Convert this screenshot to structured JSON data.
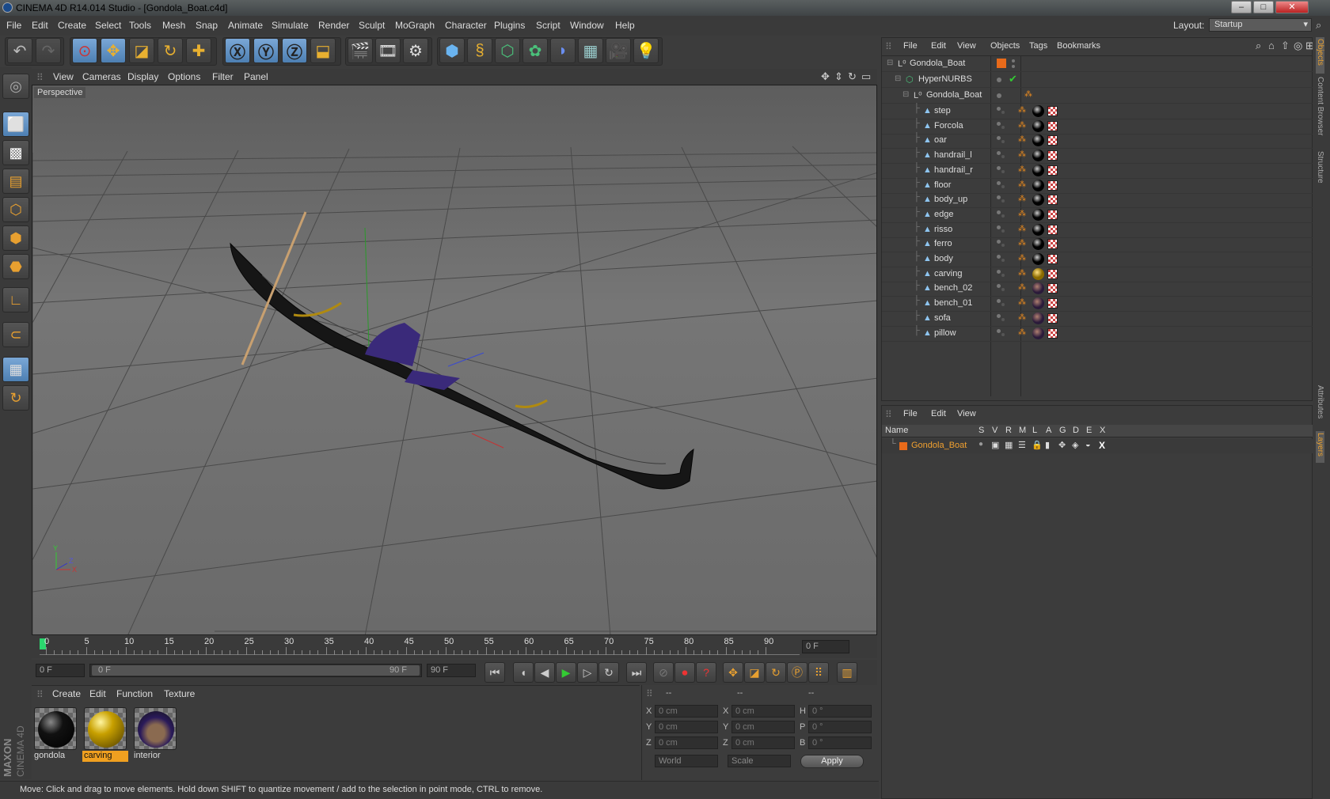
{
  "window": {
    "title": "CINEMA 4D R14.014 Studio - [Gondola_Boat.c4d]"
  },
  "menu": [
    "File",
    "Edit",
    "Create",
    "Select",
    "Tools",
    "Mesh",
    "Snap",
    "Animate",
    "Simulate",
    "Render",
    "Sculpt",
    "MoGraph",
    "Character",
    "Plugins",
    "Script",
    "Window",
    "Help"
  ],
  "layout": {
    "label": "Layout:",
    "value": "Startup"
  },
  "viewport": {
    "menu": [
      "View",
      "Cameras",
      "Display",
      "Options",
      "Filter",
      "Panel"
    ],
    "label": "Perspective"
  },
  "timeline": {
    "ticks": [
      "0",
      "5",
      "10",
      "15",
      "20",
      "25",
      "30",
      "35",
      "40",
      "45",
      "50",
      "55",
      "60",
      "65",
      "70",
      "75",
      "80",
      "85",
      "90"
    ],
    "frame_display": "0 F",
    "start_field": "0 F",
    "range_start": "0 F",
    "range_end": "90 F",
    "end_field": "90 F"
  },
  "materials": {
    "menu": [
      "Create",
      "Edit",
      "Function",
      "Texture"
    ],
    "items": [
      {
        "name": "gondola",
        "color": "#111111"
      },
      {
        "name": "carving",
        "color": "#c8a000"
      },
      {
        "name": "interior",
        "color": "#4a3a7a"
      }
    ]
  },
  "coords": {
    "headers": [
      "--",
      "--",
      "--"
    ],
    "rows": [
      {
        "a": "X",
        "av": "0 cm",
        "b": "X",
        "bv": "0 cm",
        "c": "H",
        "cv": "0 °"
      },
      {
        "a": "Y",
        "av": "0 cm",
        "b": "Y",
        "bv": "0 cm",
        "c": "P",
        "cv": "0 °"
      },
      {
        "a": "Z",
        "av": "0 cm",
        "b": "Z",
        "bv": "0 cm",
        "c": "B",
        "cv": "0 °"
      }
    ],
    "world": "World",
    "scale": "Scale",
    "apply": "Apply"
  },
  "status": "Move: Click and drag to move elements. Hold down SHIFT to quantize movement / add to the selection in point mode, CTRL to remove.",
  "objects": {
    "menu": [
      "File",
      "Edit",
      "View",
      "Objects",
      "Tags",
      "Bookmarks"
    ],
    "root": "Gondola_Boat",
    "nurbs": "HyperNURBS",
    "group": "Gondola_Boat",
    "items": [
      "step",
      "Forcola",
      "oar",
      "handrail_l",
      "handrail_r",
      "floor",
      "body_up",
      "edge",
      "risso",
      "ferro",
      "body",
      "carving",
      "bench_02",
      "bench_01",
      "sofa",
      "pillow"
    ]
  },
  "layers": {
    "menu": [
      "File",
      "Edit",
      "View"
    ],
    "header": {
      "name": "Name",
      "cols": [
        "S",
        "V",
        "R",
        "M",
        "L",
        "A",
        "G",
        "D",
        "E",
        "X"
      ]
    },
    "row": "Gondola_Boat",
    "accent": "#e87a1a"
  },
  "side_tabs": [
    "Objects",
    "Content Browser",
    "Structure",
    "Attributes",
    "Layers"
  ],
  "logo": "MAXON CINEMA 4D"
}
